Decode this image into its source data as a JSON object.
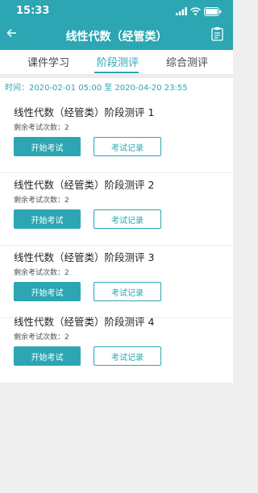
{
  "status": {
    "time": "15:33"
  },
  "nav": {
    "title": "线性代数（经管类）"
  },
  "tabs": [
    {
      "label": "课件学习"
    },
    {
      "label": "阶段测评"
    },
    {
      "label": "综合测评"
    }
  ],
  "active_tab_index": 1,
  "period": "时间：2020-02-01 05:00 至 2020-04-20 23:55",
  "tests": [
    {
      "title": "线性代数（经管类）阶段测评 1",
      "remaining": "剩余考试次数：2",
      "start_label": "开始考试",
      "record_label": "考试记录"
    },
    {
      "title": "线性代数（经管类）阶段测评 2",
      "remaining": "剩余考试次数：2",
      "start_label": "开始考试",
      "record_label": "考试记录"
    },
    {
      "title": "线性代数（经管类）阶段测评 3",
      "remaining": "剩余考试次数：2",
      "start_label": "开始考试",
      "record_label": "考试记录"
    },
    {
      "title": "线性代数（经管类）阶段测评 4",
      "remaining": "剩余考试次数：2",
      "start_label": "开始考试",
      "record_label": "考试记录"
    }
  ],
  "colors": {
    "accent": "#2ba6b2",
    "background": "#efefef"
  },
  "icons": [
    "signal-icon",
    "wifi-icon",
    "battery-icon",
    "back-arrow-icon",
    "clipboard-icon"
  ]
}
